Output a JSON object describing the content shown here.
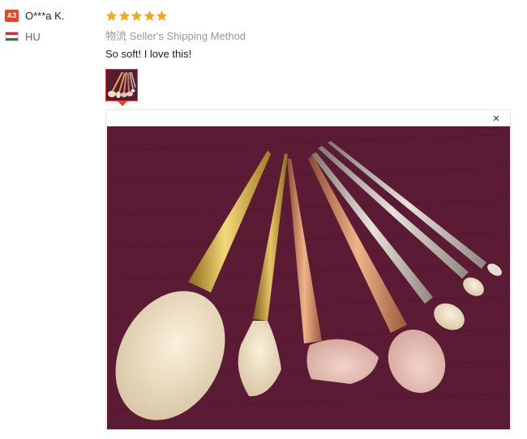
{
  "reviewer": {
    "level_badge": "A3",
    "name": "O***a K.",
    "country_code": "HU",
    "flag_colors": [
      "#cd2a3e",
      "#ffffff",
      "#436f4d"
    ]
  },
  "review": {
    "rating": 5,
    "star_color": "#f5a623",
    "shipping_label": "物流",
    "shipping_method": "Seller's Shipping Method",
    "text": "So soft! I love this!"
  },
  "photo_viewer": {
    "close_icon": "×",
    "photo_icon": "makeup-brush-set-photo"
  },
  "colors": {
    "accent": "#e0442b",
    "photo_background": "#5a1a33"
  }
}
